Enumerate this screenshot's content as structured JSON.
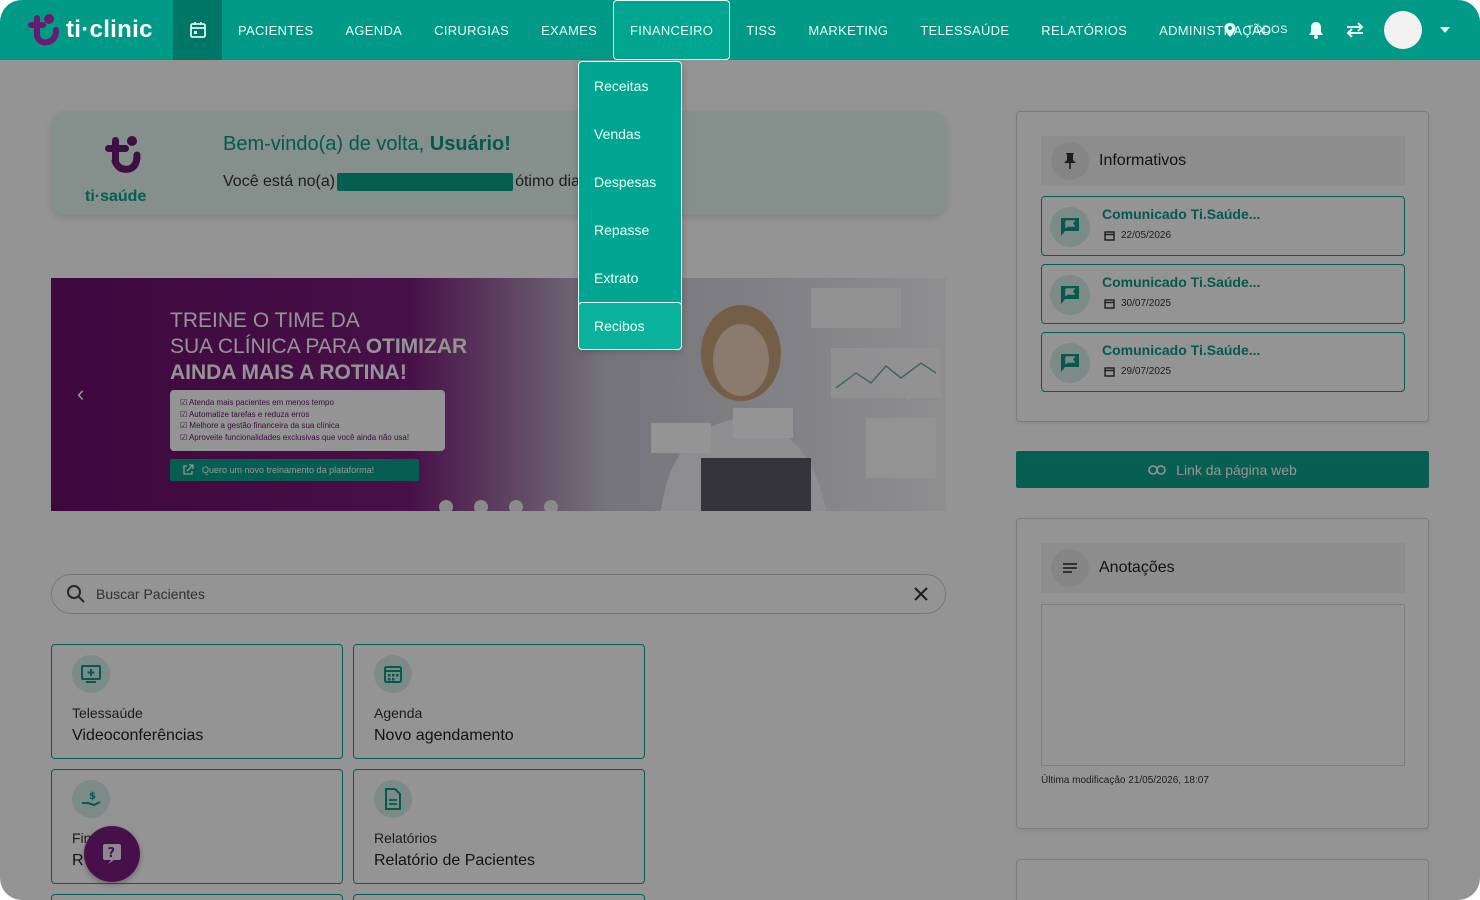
{
  "app": {
    "brand": "ti·clinic",
    "accent": "#009a86",
    "secondary": "#7a1c80"
  },
  "nav": {
    "items": [
      "PACIENTES",
      "AGENDA",
      "CIRURGIAS",
      "EXAMES",
      "FINANCEIRO",
      "TISS",
      "MARKETING",
      "TELESSAÚDE",
      "RELATÓRIOS",
      "ADMINISTRAÇÃO"
    ],
    "active": "FINANCEIRO",
    "location": "TODOS"
  },
  "dropdown": {
    "items": [
      "Receitas",
      "Vendas",
      "Despesas",
      "Repasse",
      "Extrato",
      "Recibos"
    ],
    "selected": "Recibos"
  },
  "welcome": {
    "logo_text": "ti·saúde",
    "title_prefix": "Bem-vindo(a) de volta, ",
    "user": "Usuário!",
    "sub_prefix": "Você está no(a)",
    "sub_suffix": "ótimo dia"
  },
  "banner": {
    "line1": "TREINE O TIME DA",
    "line2": "SUA CLÍNICA PARA ",
    "line2_bold": "OTIMIZAR",
    "line3": "AINDA MAIS A ROTINA!",
    "bullets": [
      "Atenda mais pacientes em menos tempo",
      "Automatize tarefas e reduza erros",
      "Melhore a gestão financeira da sua clínica",
      "Aproveite funcionalidades exclusivas que você ainda não usa!"
    ],
    "cta": "Quero um novo treinamento da plataforma!"
  },
  "search": {
    "placeholder": "Buscar Pacientes"
  },
  "cards": [
    {
      "title": "Telessaúde",
      "subtitle": "Videoconferências",
      "icon": "video-call-icon"
    },
    {
      "title": "Agenda",
      "subtitle": "Novo agendamento",
      "icon": "calendar-icon"
    },
    {
      "title": "Fin",
      "subtitle": "R",
      "icon": "money-hand-icon"
    },
    {
      "title": "Relatórios",
      "subtitle": "Relatório de Pacientes",
      "icon": "document-icon"
    }
  ],
  "informativos": {
    "title": "Informativos",
    "items": [
      {
        "title": "Comunicado Ti.Saúde...",
        "date": "22/05/2026"
      },
      {
        "title": "Comunicado Ti.Saúde...",
        "date": "30/07/2025"
      },
      {
        "title": "Comunicado Ti.Saúde...",
        "date": "29/07/2025"
      }
    ]
  },
  "weblink": {
    "label": "Link da página web"
  },
  "notes": {
    "title": "Anotações",
    "last_modified": "Última modificação 21/05/2026, 18:07"
  }
}
